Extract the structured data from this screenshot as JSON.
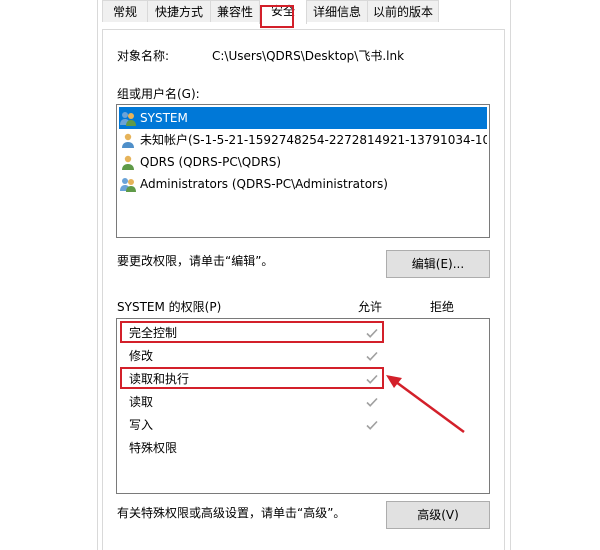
{
  "tabs": [
    {
      "label": "常规"
    },
    {
      "label": "快捷方式"
    },
    {
      "label": "兼容性"
    },
    {
      "label": "安全"
    },
    {
      "label": "详细信息"
    },
    {
      "label": "以前的版本"
    }
  ],
  "object": {
    "label": "对象名称:",
    "value": "C:\\Users\\QDRS\\Desktop\\飞书.lnk"
  },
  "groups": {
    "label": "组或用户名(G):",
    "users": [
      {
        "name": "SYSTEM",
        "icon": "group-users-icon"
      },
      {
        "name": "未知帐户(S-1-5-21-1592748254-2272814921-13791034-10...",
        "icon": "single-user-icon"
      },
      {
        "name": "QDRS (QDRS-PC\\QDRS)",
        "icon": "single-user-icon"
      },
      {
        "name": "Administrators (QDRS-PC\\Administrators)",
        "icon": "group-users-icon"
      }
    ]
  },
  "edit": {
    "hint": "要更改权限，请单击“编辑”。",
    "button_label": "编辑(E)..."
  },
  "permissions": {
    "label": "SYSTEM 的权限(P)",
    "allow_header": "允许",
    "deny_header": "拒绝",
    "rows": [
      {
        "name": "完全控制",
        "allow": true
      },
      {
        "name": "修改",
        "allow": true
      },
      {
        "name": "读取和执行",
        "allow": true
      },
      {
        "name": "读取",
        "allow": true
      },
      {
        "name": "写入",
        "allow": true
      },
      {
        "name": "特殊权限",
        "allow": false
      }
    ]
  },
  "advanced": {
    "hint": "有关特殊权限或高级设置，请单击“高级”。",
    "button_label": "高级(V)"
  },
  "colors": {
    "highlight": "#d3202a",
    "selection": "#0078d7",
    "check": "#a0a0a0"
  }
}
